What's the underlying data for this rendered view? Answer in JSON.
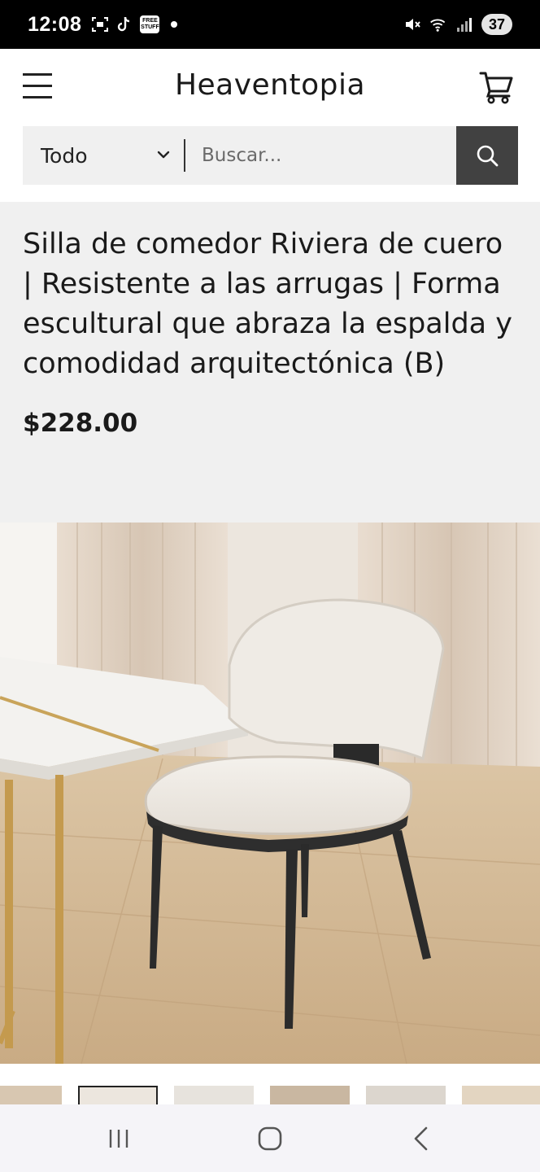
{
  "status_bar": {
    "time": "12:08",
    "free_badge": "FREE STUFF",
    "battery": "37"
  },
  "header": {
    "brand": "Heaventopia"
  },
  "search": {
    "category": "Todo",
    "placeholder": "Buscar..."
  },
  "product": {
    "title": "Silla de comedor Riviera de cuero | Resistente a las arrugas | Forma escultural que abraza la espalda y comodidad arquitectónica (B)",
    "price": "$228.00"
  },
  "thumbnails": {
    "count_visible": 6,
    "active_index": 1
  },
  "icons": {
    "menu": "menu-icon",
    "cart": "cart-icon",
    "search": "search-icon",
    "chevron": "chevron-down-icon",
    "recents": "recent-apps-icon",
    "home": "home-icon",
    "back": "back-icon"
  }
}
